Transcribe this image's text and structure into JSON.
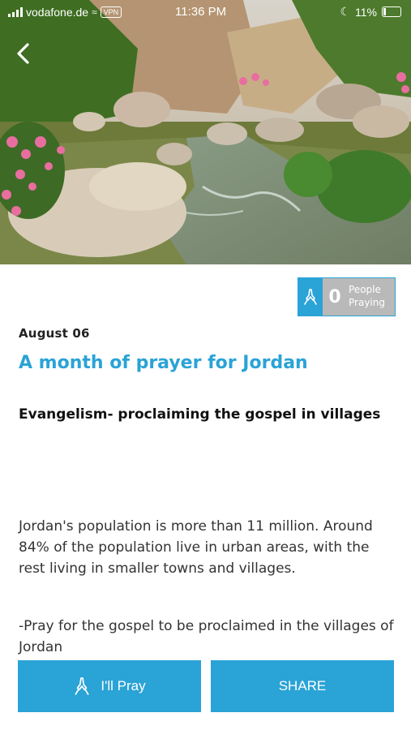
{
  "status_bar": {
    "carrier": "vodafone.de",
    "vpn": "VPN",
    "time": "11:36 PM",
    "battery": "11%"
  },
  "icons": {
    "back": "chevron-left-icon",
    "pray": "praying-hands-icon"
  },
  "praying_badge": {
    "count": "0",
    "label_line1": "People",
    "label_line2": "Praying"
  },
  "date": "August 06",
  "title": "A month of prayer for Jordan",
  "subtitle": "Evangelism- proclaiming the gospel in villages",
  "body": [
    "Jordan's population is more than 11 million. Around 84% of the population live in urban areas, with the rest living in smaller towns and villages.",
    "-Pray for the gospel to be proclaimed in the villages of Jordan"
  ],
  "buttons": {
    "pray": "I'll Pray",
    "share": "SHARE"
  },
  "colors": {
    "accent": "#2aa3d6",
    "badge_gray": "#b9b9b9"
  }
}
